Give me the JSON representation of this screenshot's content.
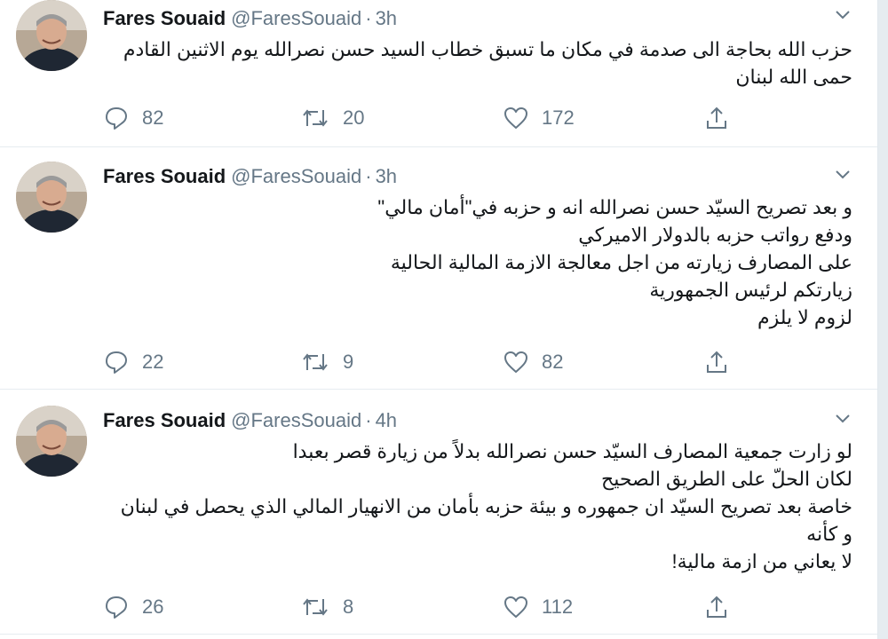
{
  "tweets": [
    {
      "name": "Fares Souaid",
      "handle": "@FaresSouaid",
      "separator": "·",
      "time": "3h",
      "lines": [
        "حزب الله بحاجة الى صدمة في مكان ما تسبق خطاب السيد حسن نصرالله يوم الاثنين القادم",
        "حمى الله لبنان"
      ],
      "replies": "82",
      "retweets": "20",
      "likes": "172"
    },
    {
      "name": "Fares Souaid",
      "handle": "@FaresSouaid",
      "separator": "·",
      "time": "3h",
      "lines": [
        "و بعد تصريح السيّد حسن نصرالله انه و حزبه في\"أمان مالي\"",
        "ودفع رواتب حزبه بالدولار الاميركي",
        "على المصارف زيارته من اجل معالجة الازمة المالية الحالية",
        "زيارتكم لرئيس الجمهورية",
        "لزوم لا يلزم"
      ],
      "replies": "22",
      "retweets": "9",
      "likes": "82"
    },
    {
      "name": "Fares Souaid",
      "handle": "@FaresSouaid",
      "separator": "·",
      "time": "4h",
      "lines": [
        "لو زارت جمعية المصارف السيّد حسن نصرالله بدلاً من زيارة قصر بعبدا",
        "لكان الحلّ على الطريق الصحيح",
        "خاصة بعد تصريح السيّد ان جمهوره و بيئة حزبه بأمان من الانهيار المالي الذي يحصل في لبنان",
        "و كأنه",
        "لا يعاني من ازمة مالية!"
      ],
      "replies": "26",
      "retweets": "8",
      "likes": "112"
    }
  ],
  "icons": {
    "reply": "reply-icon",
    "retweet": "retweet-icon",
    "like": "like-icon",
    "share": "share-icon",
    "more": "chevron-down-icon",
    "avatar": "avatar"
  },
  "colors": {
    "text": "#14171a",
    "secondary": "#657786",
    "divider": "#e6ecf0",
    "background": "#ffffff"
  }
}
